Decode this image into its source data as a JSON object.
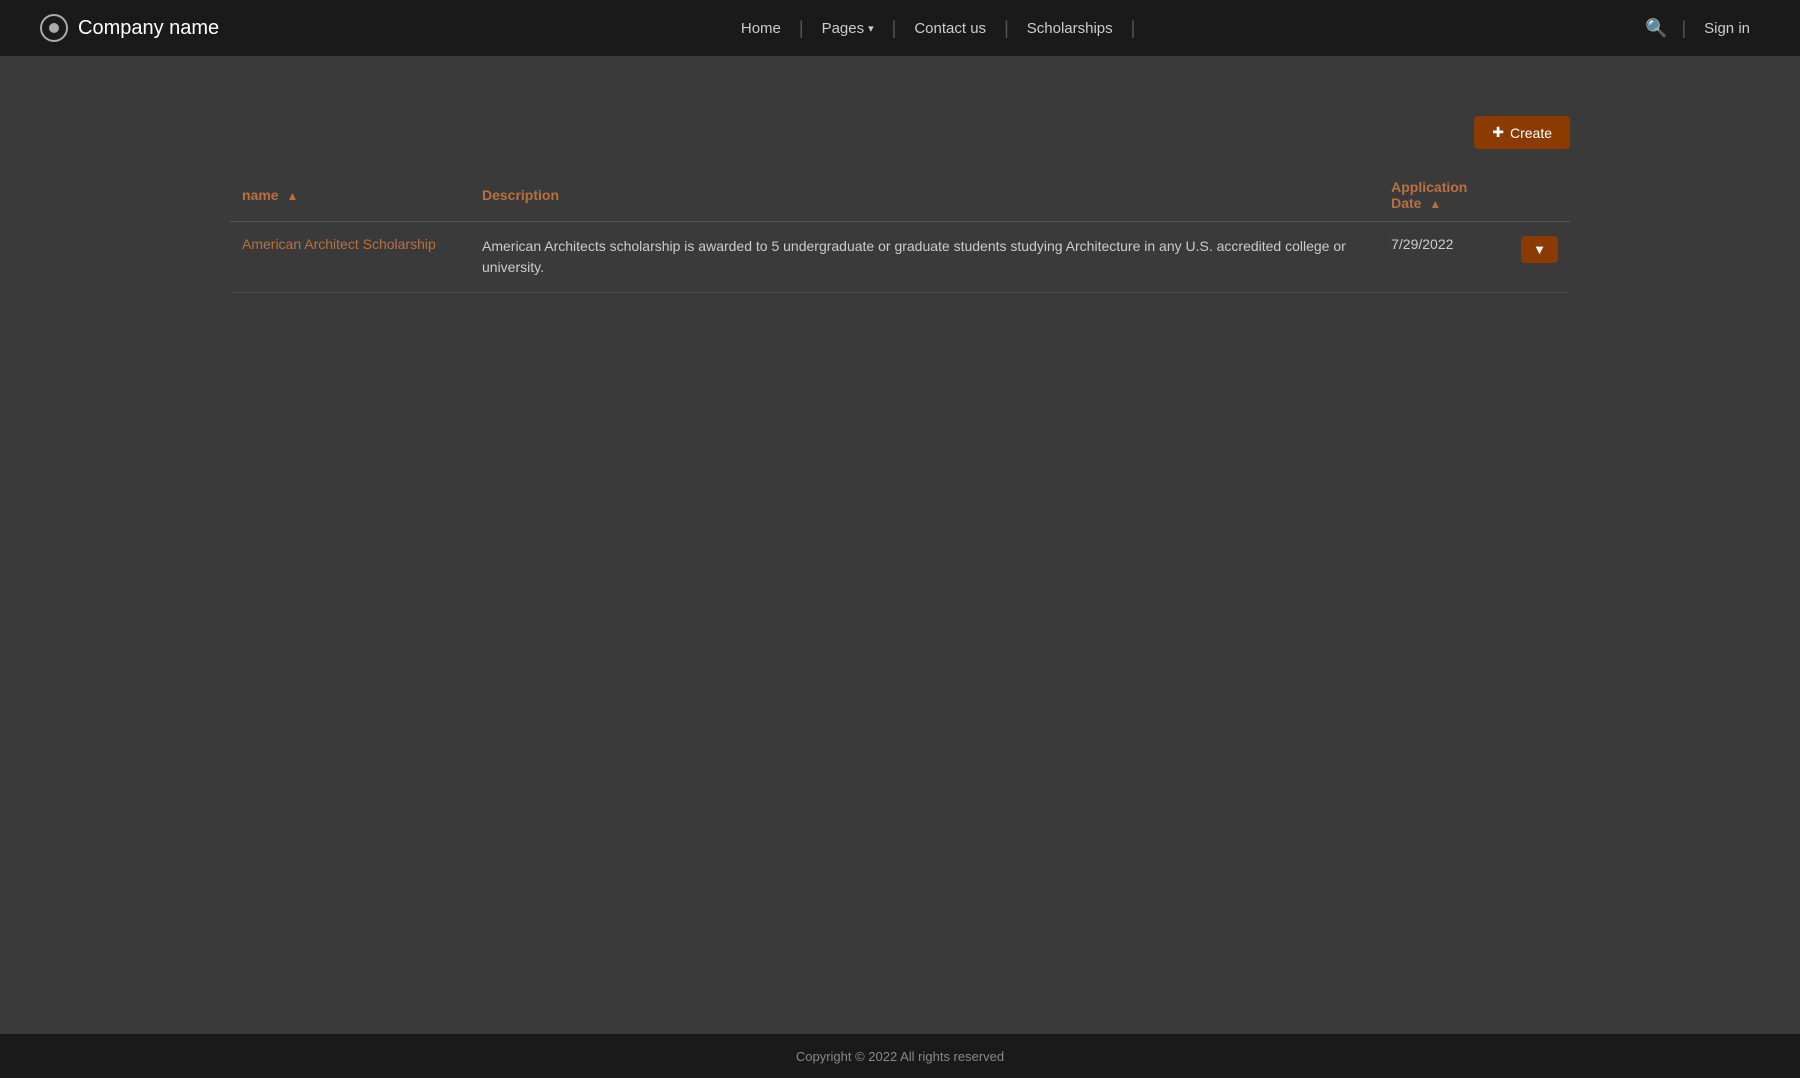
{
  "nav": {
    "brand_name": "Company name",
    "links": [
      {
        "label": "Home",
        "id": "home"
      },
      {
        "label": "Pages",
        "id": "pages",
        "has_dropdown": true
      },
      {
        "label": "Contact us",
        "id": "contact"
      },
      {
        "label": "Scholarships",
        "id": "scholarships"
      }
    ],
    "search_label": "search",
    "signin_label": "Sign in"
  },
  "toolbar": {
    "create_label": "Create"
  },
  "table": {
    "columns": [
      {
        "id": "name",
        "label": "name",
        "sortable": true
      },
      {
        "id": "description",
        "label": "Description",
        "sortable": false
      },
      {
        "id": "application_date",
        "label": "Application Date",
        "sortable": true
      }
    ],
    "rows": [
      {
        "name": "American Architect Scholarship",
        "description": "American Architects scholarship is awarded to 5 undergraduate or graduate students studying Architecture in any U.S. accredited college or university.",
        "application_date": "7/29/2022"
      }
    ]
  },
  "footer": {
    "copyright": "Copyright © 2022  All rights reserved"
  }
}
